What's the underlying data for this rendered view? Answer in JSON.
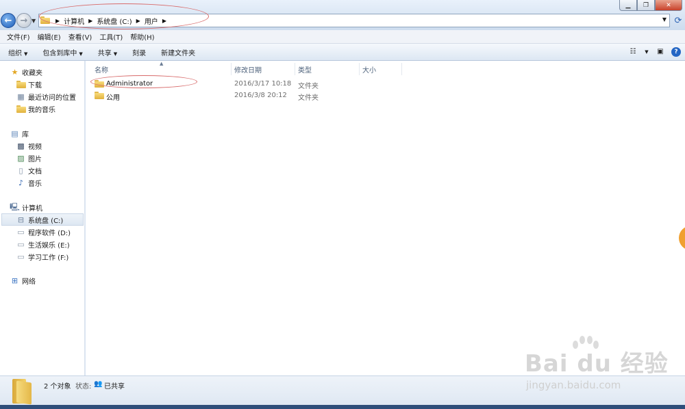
{
  "address_bar": {
    "crumbs": [
      "计算机",
      "系统盘 (C:)",
      "用户"
    ]
  },
  "menu": {
    "items": [
      "文件(F)",
      "编辑(E)",
      "查看(V)",
      "工具(T)",
      "帮助(H)"
    ]
  },
  "toolbar": {
    "organize": "组织",
    "include_library": "包含到库中",
    "share": "共享",
    "burn": "刻录",
    "new_folder": "新建文件夹"
  },
  "nav": {
    "favorites": "收藏夹",
    "downloads": "下载",
    "recent": "最近访问的位置",
    "my_music": "我的音乐",
    "libraries": "库",
    "videos": "视频",
    "pictures": "图片",
    "documents": "文档",
    "music": "音乐",
    "computer": "计算机",
    "drive_c": "系统盘 (C:)",
    "drive_d": "程序软件 (D:)",
    "drive_e": "生活娱乐 (E:)",
    "drive_f": "学习工作 (F:)",
    "network": "网络"
  },
  "columns": {
    "name": "名称",
    "modified": "修改日期",
    "type": "类型",
    "size": "大小"
  },
  "files": [
    {
      "name": "Administrator",
      "modified": "2016/3/17 10:18",
      "type": "文件夹"
    },
    {
      "name": "公用",
      "modified": "2016/3/8 20:12",
      "type": "文件夹"
    }
  ],
  "status": {
    "count": "2 个对象",
    "state_label": "状态:",
    "state_value": "已共享"
  },
  "watermark": {
    "brand": "Bai du 经验",
    "url": "jingyan.baidu.com"
  },
  "colors": {
    "annotation_ellipse": "#d86a6a",
    "folder": "#e0b13c",
    "accent": "#2466c4"
  }
}
